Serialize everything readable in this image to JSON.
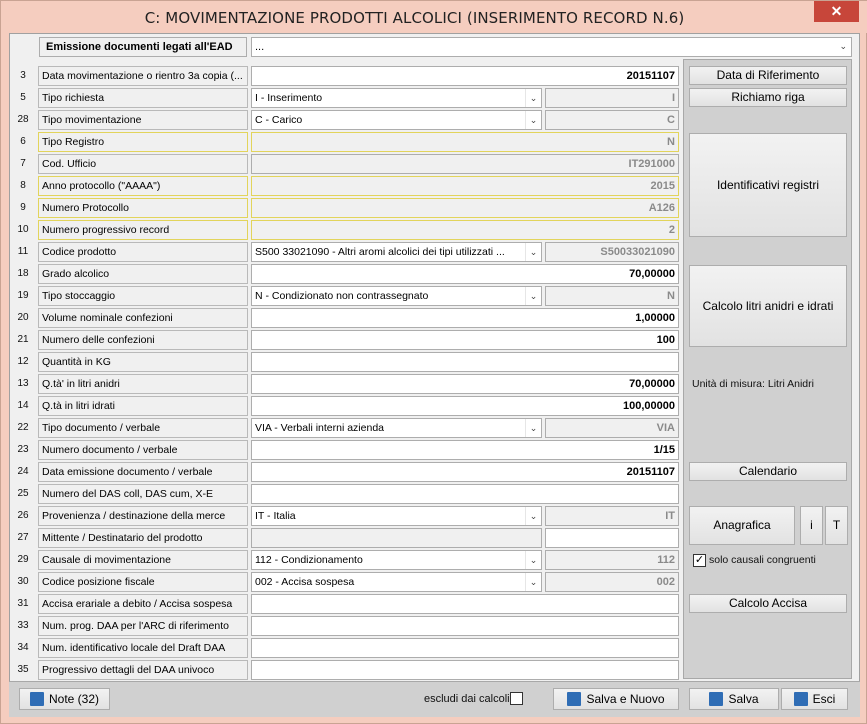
{
  "window": {
    "title": "C: MOVIMENTAZIONE PRODOTTI ALCOLICI (INSERIMENTO RECORD N.6)",
    "close_glyph": "✕"
  },
  "ead": {
    "label": "Emissione documenti legati all'EAD",
    "value": "...",
    "arrow": "⌄"
  },
  "rows": {
    "r3": {
      "num": "3",
      "label": "Data movimentazione o rientro 3a copia (...",
      "value": "20151107"
    },
    "r5": {
      "num": "5",
      "label": "Tipo richiesta",
      "combo": "I - Inserimento",
      "code": "I"
    },
    "r28": {
      "num": "28",
      "label": "Tipo movimentazione",
      "combo": "C - Carico",
      "code": "C"
    },
    "r6": {
      "num": "6",
      "label": "Tipo Registro",
      "value": "N"
    },
    "r7": {
      "num": "7",
      "label": "Cod. Ufficio",
      "value": "IT291000"
    },
    "r8": {
      "num": "8",
      "label": "Anno protocollo (\"AAAA\")",
      "value": "2015"
    },
    "r9": {
      "num": "9",
      "label": "Numero Protocollo",
      "value": "A126"
    },
    "r10": {
      "num": "10",
      "label": "Numero progressivo record",
      "value": "2"
    },
    "r11": {
      "num": "11",
      "label": "Codice prodotto",
      "combo": "S500 33021090   - Altri aromi alcolici dei tipi utilizzati ...",
      "code": "S50033021090"
    },
    "r18": {
      "num": "18",
      "label": "Grado alcolico",
      "value": "70,00000"
    },
    "r19": {
      "num": "19",
      "label": "Tipo stoccaggio",
      "combo": "N - Condizionato non contrassegnato",
      "code": "N"
    },
    "r20": {
      "num": "20",
      "label": "Volume nominale confezioni",
      "value": "1,00000"
    },
    "r21": {
      "num": "21",
      "label": "Numero delle confezioni",
      "value": "100"
    },
    "r12": {
      "num": "12",
      "label": "Quantità in KG",
      "value": ""
    },
    "r13": {
      "num": "13",
      "label": "Q.tà' in litri anidri",
      "value": "70,00000"
    },
    "r14": {
      "num": "14",
      "label": "Q.tà in litri idrati",
      "value": "100,00000"
    },
    "r22": {
      "num": "22",
      "label": "Tipo documento / verbale",
      "combo": "VIA - Verbali interni azienda",
      "code": "VIA"
    },
    "r23": {
      "num": "23",
      "label": "Numero documento / verbale",
      "value": "1/15"
    },
    "r24": {
      "num": "24",
      "label": "Data emissione documento / verbale",
      "value": "20151107"
    },
    "r25": {
      "num": "25",
      "label": "Numero del DAS coll, DAS cum, X-E",
      "value": ""
    },
    "r26": {
      "num": "26",
      "label": "Provenienza / destinazione della merce",
      "combo": "IT - Italia",
      "code": "IT"
    },
    "r27": {
      "num": "27",
      "label": "Mittente / Destinatario del prodotto",
      "value": ""
    },
    "r29": {
      "num": "29",
      "label": "Causale di movimentazione",
      "combo": "112 - Condizionamento",
      "code": "112"
    },
    "r30": {
      "num": "30",
      "label": "Codice posizione fiscale",
      "combo": "002 - Accisa sospesa",
      "code": "002"
    },
    "r31": {
      "num": "31",
      "label": "Accisa erariale a debito / Accisa sospesa",
      "value": ""
    },
    "r33": {
      "num": "33",
      "label": "Num. prog. DAA per l'ARC di  riferimento",
      "value": ""
    },
    "r34": {
      "num": "34",
      "label": "Num. identificativo locale del Draft DAA",
      "value": ""
    },
    "r35": {
      "num": "35",
      "label": "Progressivo dettagli del DAA univoco",
      "value": ""
    }
  },
  "combo_arrow": "⌄",
  "panel": {
    "data_rif": "Data di Riferimento",
    "richiamo": "Richiamo riga",
    "identificativi": "Identificativi registri",
    "calcolo_litri": "Calcolo litri anidri e idrati",
    "unita": "Unità di misura: Litri Anidri",
    "calendario": "Calendario",
    "anagrafica": "Anagrafica",
    "i_btn": "i",
    "t_btn": "T",
    "solo_causali": "solo causali congruenti",
    "solo_causali_checked": "✓",
    "calcolo_accisa": "Calcolo Accisa"
  },
  "bottom": {
    "note": "Note (32)",
    "escludi": "escludi dai calcoli",
    "salva_nuovo": "Salva e Nuovo",
    "salva": "Salva",
    "esci": "Esci"
  },
  "colors": {
    "window_frame": "#f5cdbf",
    "close": "#c7463a",
    "panel": "#d0d0d0",
    "readonly": "#f0f0f0",
    "highlight_border": "#e2d45b",
    "icon_blue": "#2f6db5"
  },
  "icons": {
    "note": "note-icon",
    "save_new": "floppy-icon",
    "save": "floppy-icon",
    "exit": "exit-x-icon"
  }
}
